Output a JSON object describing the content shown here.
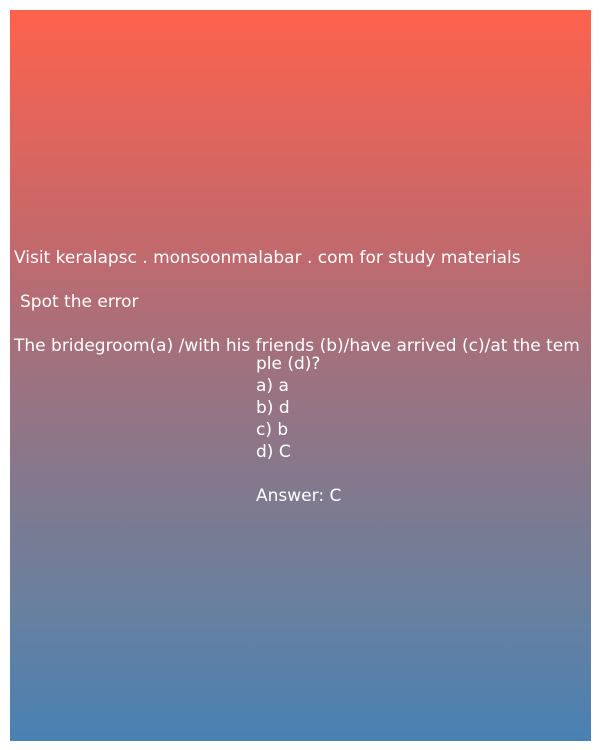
{
  "site_text": "Visit keralapsc . monsoonmalabar . com for study materials",
  "instruction": "Spot the error",
  "question": {
    "first_line": "The bridegroom(a) /with his friends (b)/have arrived (c)/at the tem",
    "second_line": "ple (d)?"
  },
  "options": [
    "a) a",
    "b) d",
    "c) b",
    "d) C"
  ],
  "answer": "Answer: C"
}
